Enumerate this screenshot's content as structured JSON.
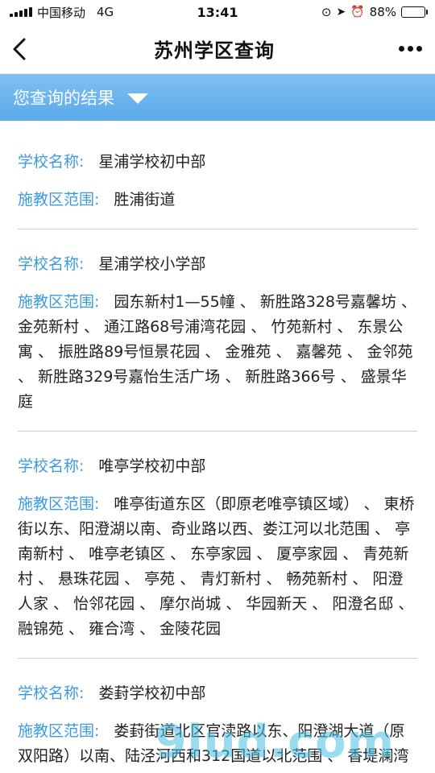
{
  "status_bar": {
    "carrier": "中国移动",
    "network": "4G",
    "time": "13:41",
    "battery_percent": "88%",
    "battery_level": 0.88
  },
  "nav": {
    "title": "苏州学区查询"
  },
  "result_bar": {
    "label": "您查询的结果"
  },
  "labels": {
    "school_name": "学校名称:",
    "district_range": "施教区范围:"
  },
  "schools": [
    {
      "name": "星浦学校初中部",
      "range": "胜浦街道"
    },
    {
      "name": "星浦学校小学部",
      "range": "园东新村1—55幢 、 新胜路328号嘉馨坊 、 金苑新村 、 通江路68号浦湾花园 、 竹苑新村 、 东景公寓 、 振胜路89号恒景花园 、 金雅苑 、 嘉馨苑 、 金邻苑 、 新胜路329号嘉怡生活广场 、 新胜路366号 、 盛景华庭"
    },
    {
      "name": "唯亭学校初中部",
      "range": "唯亭街道东区（即原老唯亭镇区域） 、 東桥街以东、阳澄湖以南、奇业路以西、娄江河以北范围 、 亭南新村 、 唯亭老镇区 、 东亭家园 、 厦亭家园 、 青苑新村 、 悬珠花园 、 亭苑 、 青灯新村 、 畅苑新村 、 阳澄人家 、 怡邻花园 、 摩尔尚城 、 华园新天 、 阳澄名邸 、 融锦苑 、 雍合湾 、 金陵花园"
    },
    {
      "name": "娄葑学校初中部",
      "range": "娄葑街道北区官渎路以东、阳澄湖大道（原双阳路）以南、陆泾河西和312国道以北范围 、 香堤澜湾 、 临芳苑 、 泾园新村 、 泾园二村 、"
    }
  ],
  "watermark": "9lud.com"
}
